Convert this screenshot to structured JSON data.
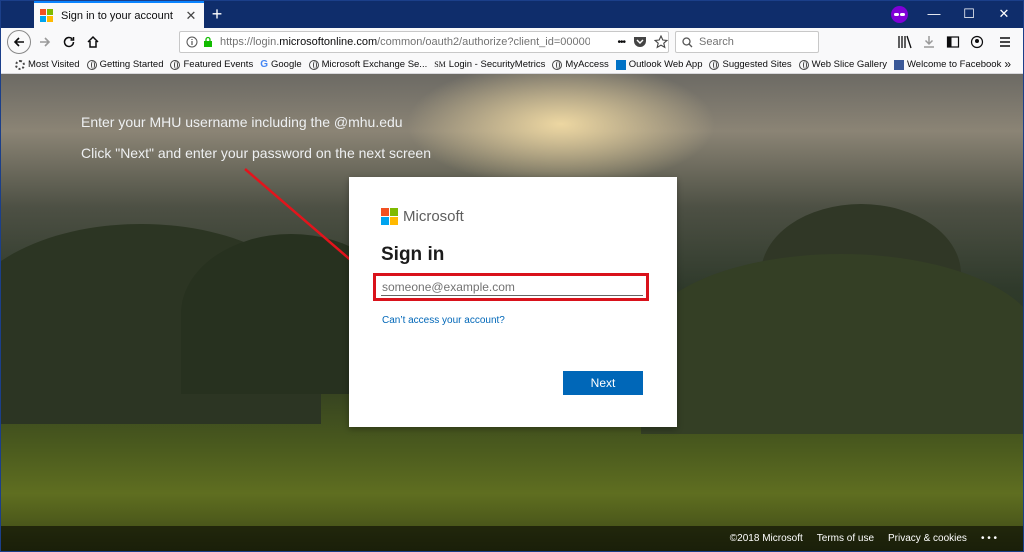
{
  "tab": {
    "title": "Sign in to your account",
    "close": "✕",
    "new_tab": "+"
  },
  "window_controls": {
    "minimize": "—",
    "maximize": "☐",
    "close": "✕"
  },
  "navbar": {
    "url_prefix": "https://login.",
    "url_domain": "microsoftonline.com",
    "url_rest": "/common/oauth2/authorize?client_id=000000",
    "search_placeholder": "Search",
    "page_actions": "•••"
  },
  "bookmarks": [
    {
      "label": "Most Visited",
      "icon": "gear-icon"
    },
    {
      "label": "Getting Started",
      "icon": "globe-icon"
    },
    {
      "label": "Featured Events",
      "icon": "globe-icon"
    },
    {
      "label": "Google",
      "icon": "google-icon"
    },
    {
      "label": "Microsoft Exchange Se...",
      "icon": "globe-icon"
    },
    {
      "label": "Login - SecurityMetrics",
      "icon": "sm-icon"
    },
    {
      "label": "MyAccess",
      "icon": "globe-icon"
    },
    {
      "label": "Outlook Web App",
      "icon": "outlook-icon"
    },
    {
      "label": "Suggested Sites",
      "icon": "globe-icon"
    },
    {
      "label": "Web Slice Gallery",
      "icon": "globe-icon"
    },
    {
      "label": "Welcome to Facebook",
      "icon": "facebook-icon"
    }
  ],
  "bookmarks_overflow": "»",
  "hints": {
    "line1": "Enter your MHU username including the @mhu.edu",
    "line2": "Click \"Next\" and enter your password on the next screen"
  },
  "card": {
    "brand": "Microsoft",
    "title": "Sign in",
    "email_placeholder": "someone@example.com",
    "email_value": "",
    "cant_access": "Can’t access your account?",
    "next_label": "Next"
  },
  "footer": {
    "copyright": "©2018 Microsoft",
    "terms": "Terms of use",
    "privacy": "Privacy & cookies",
    "more": "• • •"
  },
  "colors": {
    "accent": "#0067b8",
    "highlight_box": "#d9121b",
    "annotation_arrow": "#e3141c",
    "private_browsing": "#8000d7"
  }
}
